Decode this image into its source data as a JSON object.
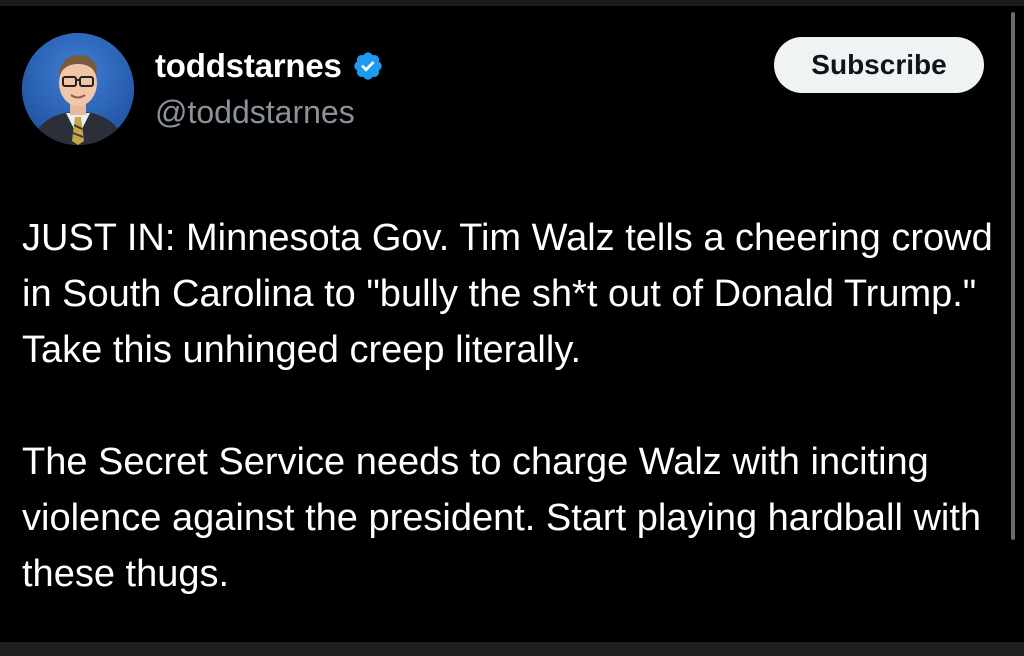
{
  "author": {
    "display_name": "toddstarnes",
    "handle": "@toddstarnes",
    "verified": true,
    "verified_color": "#1d9bf0",
    "avatar_icon": "profile-photo"
  },
  "actions": {
    "subscribe_label": "Subscribe"
  },
  "post": {
    "paragraphs": [
      "JUST IN: Minnesota Gov. Tim Walz tells a cheering crowd in South Carolina to \"bully the sh*t out of Donald Trump.\" Take this unhinged creep literally.",
      "The Secret Service needs to charge Walz with inciting violence against the president. Start playing hardball with these thugs."
    ]
  },
  "colors": {
    "background": "#000000",
    "text": "#ffffff",
    "handle": "#8b9199",
    "button_bg": "#eff3f4",
    "button_text": "#0f1419"
  }
}
